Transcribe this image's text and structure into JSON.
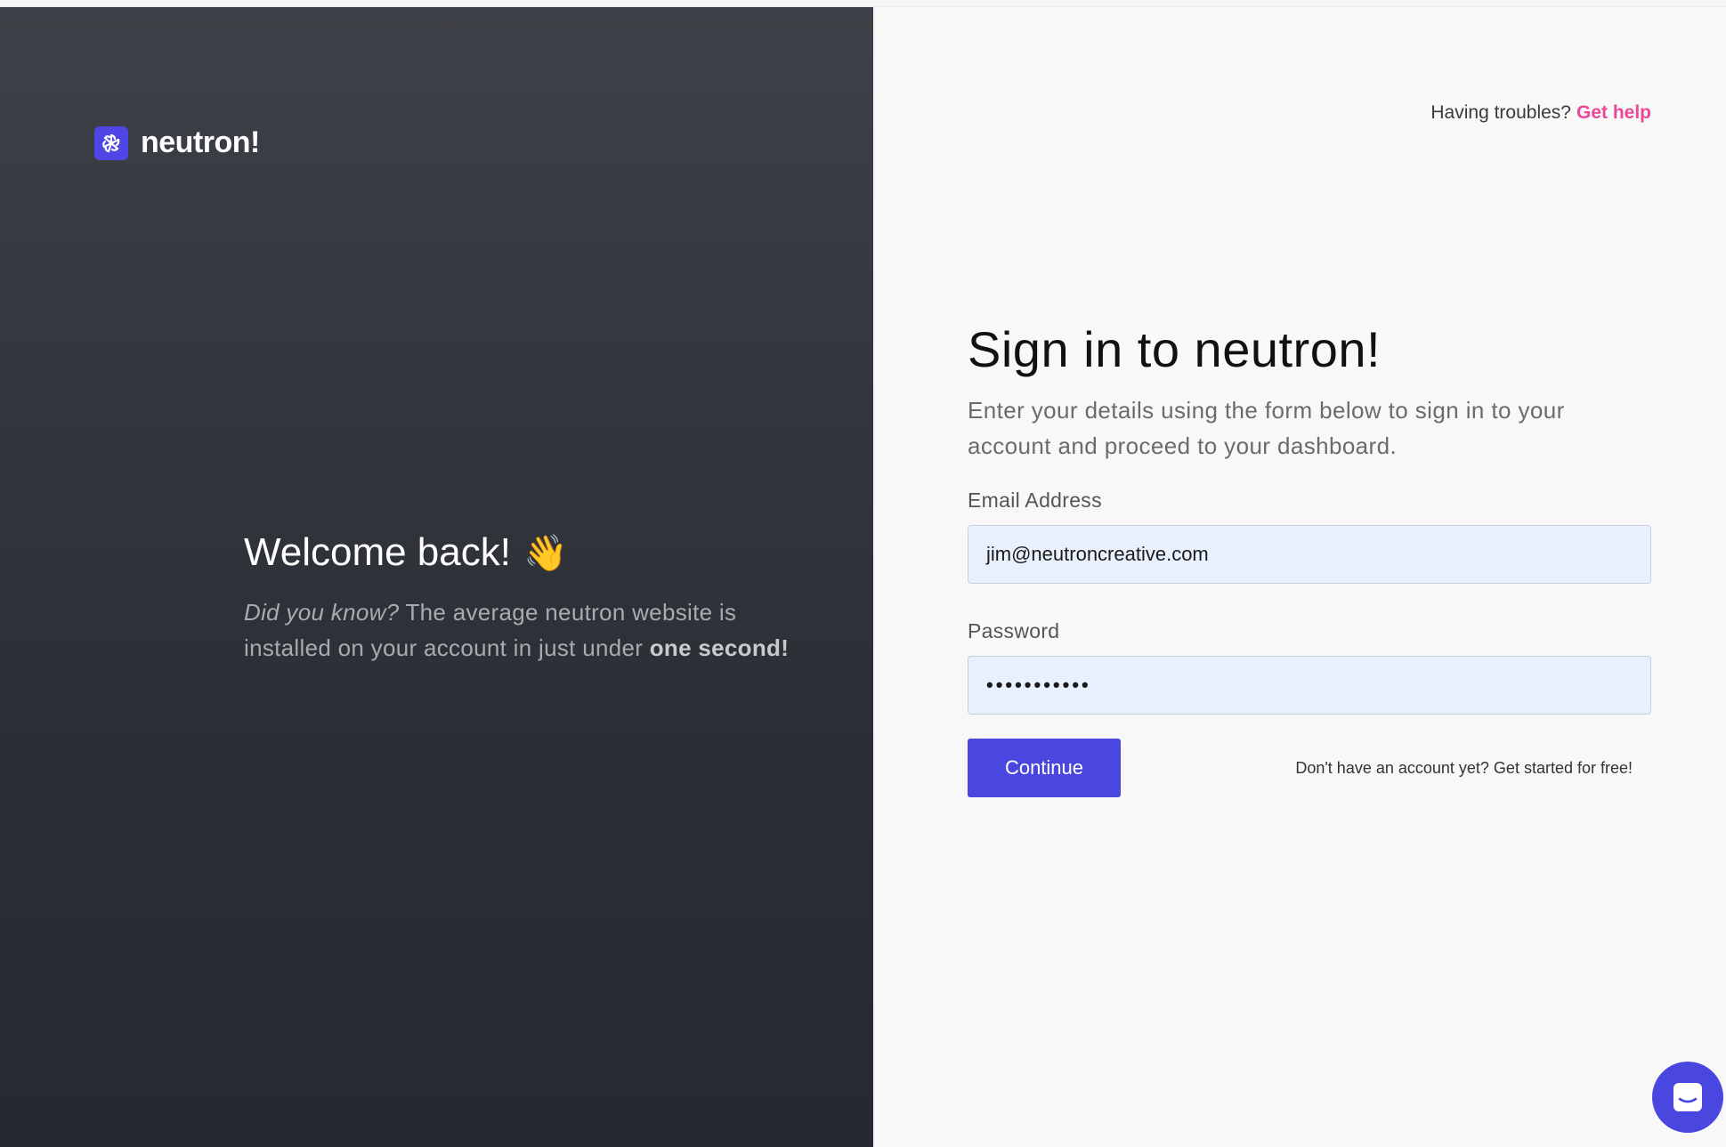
{
  "brand": {
    "name": "neutron!",
    "logo_icon": "flower-icon",
    "accent": "#4f46e5"
  },
  "left": {
    "title": "Welcome back!",
    "title_emoji": "👋",
    "fact_prefix": "Did you know?",
    "fact_body": " The average neutron website is installed on your account in just under ",
    "fact_emphasis": "one second!"
  },
  "help": {
    "question": "Having troubles?",
    "link": "Get help",
    "link_color": "#ec4899"
  },
  "form": {
    "title": "Sign in to neutron!",
    "subtitle": "Enter your details using the form below to sign in to your account and proceed to your dashboard.",
    "email_label": "Email Address",
    "email_value": "jim@neutroncreative.com",
    "password_label": "Password",
    "password_value": "•••••••••••",
    "submit_label": "Continue",
    "signup_text": "Don't have an account yet? Get started for free!"
  },
  "chat_widget": {
    "icon": "chat-icon"
  }
}
